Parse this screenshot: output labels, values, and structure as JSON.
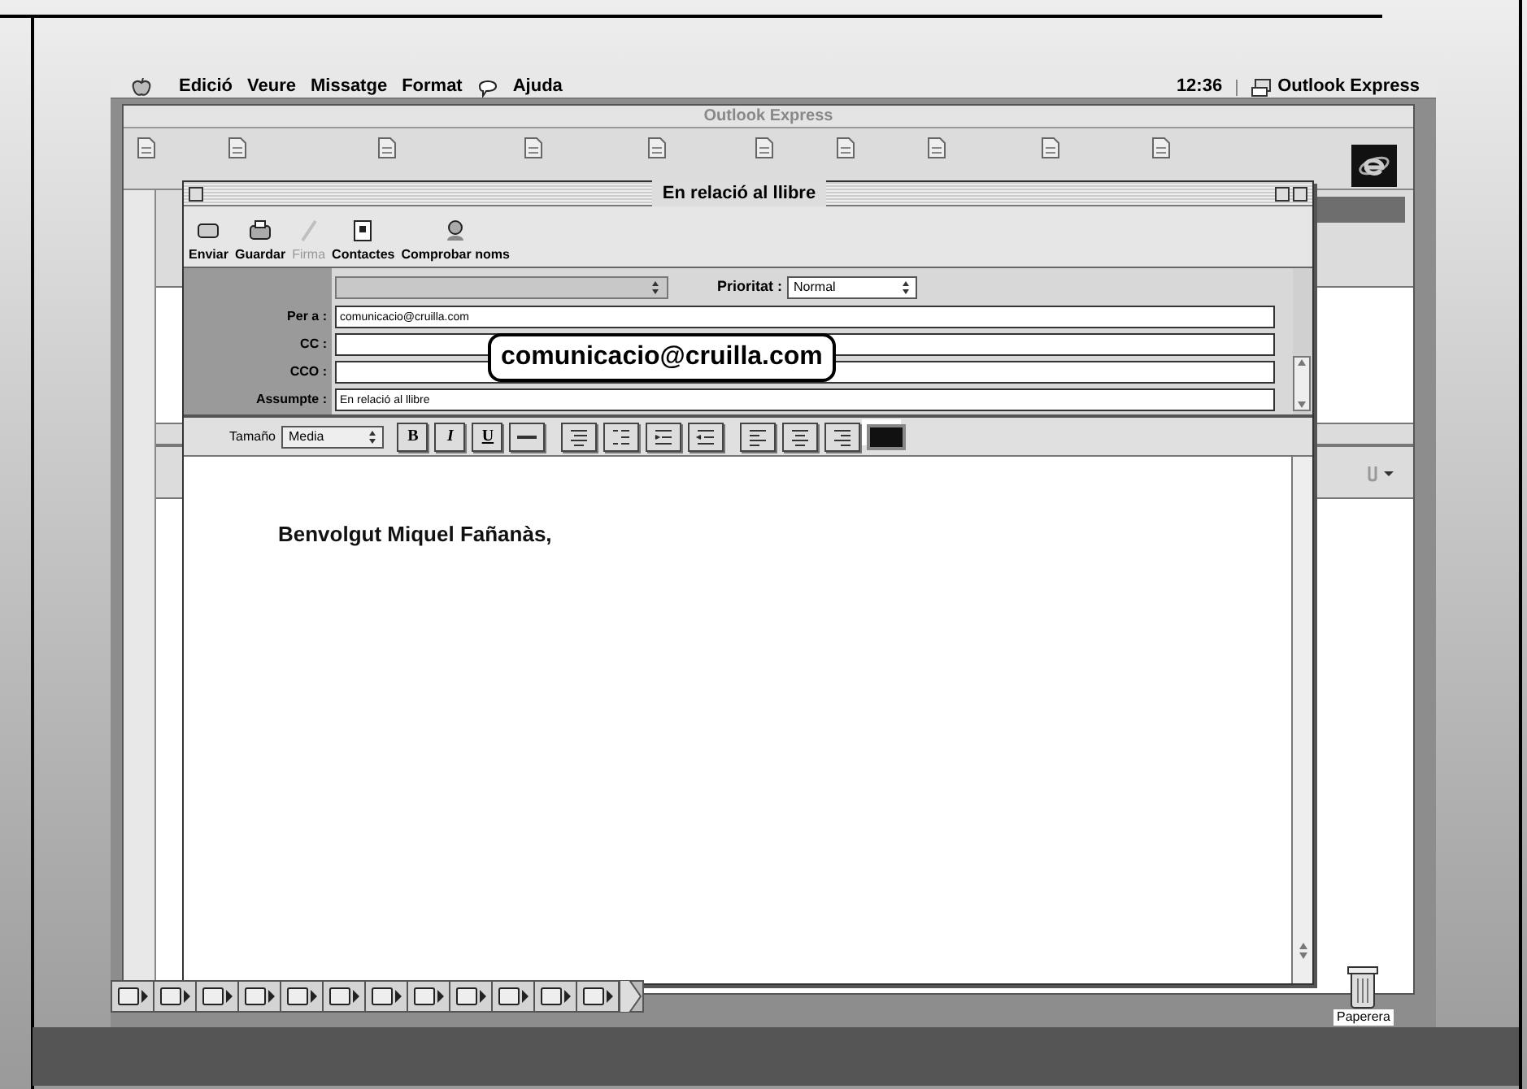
{
  "menu_bar": {
    "items": [
      "Edició",
      "Veure",
      "Missatge",
      "Format",
      "Ajuda"
    ],
    "clock": "12:36",
    "app": "Outlook Express"
  },
  "main_window": {
    "title": "Outlook Express"
  },
  "compose_window": {
    "title": "En relació al llibre",
    "toolbar": [
      {
        "label": "Enviar",
        "disabled": false
      },
      {
        "label": "Guardar",
        "disabled": false
      },
      {
        "label": "Firma",
        "disabled": true
      },
      {
        "label": "Contactes",
        "disabled": false
      },
      {
        "label": "Comprobar noms",
        "disabled": false
      }
    ],
    "priority": {
      "label": "Prioritat :",
      "value": "Normal"
    },
    "fields": [
      {
        "label": "Per a :",
        "value": "comunicacio@cruilla.com"
      },
      {
        "label": "CC :"
      },
      {
        "label": "CCO :"
      },
      {
        "label": "Assumpte :",
        "value": "En relació al llibre"
      }
    ],
    "format_bar": {
      "size_label": "Tamaño",
      "size_value": "Media",
      "style_buttons": [
        "B",
        "I",
        "U"
      ]
    },
    "body": "Benvolgut Miquel Fañanàs,"
  },
  "callout": "comunicacio@cruilla.com",
  "trash": {
    "label": "Paperera"
  }
}
